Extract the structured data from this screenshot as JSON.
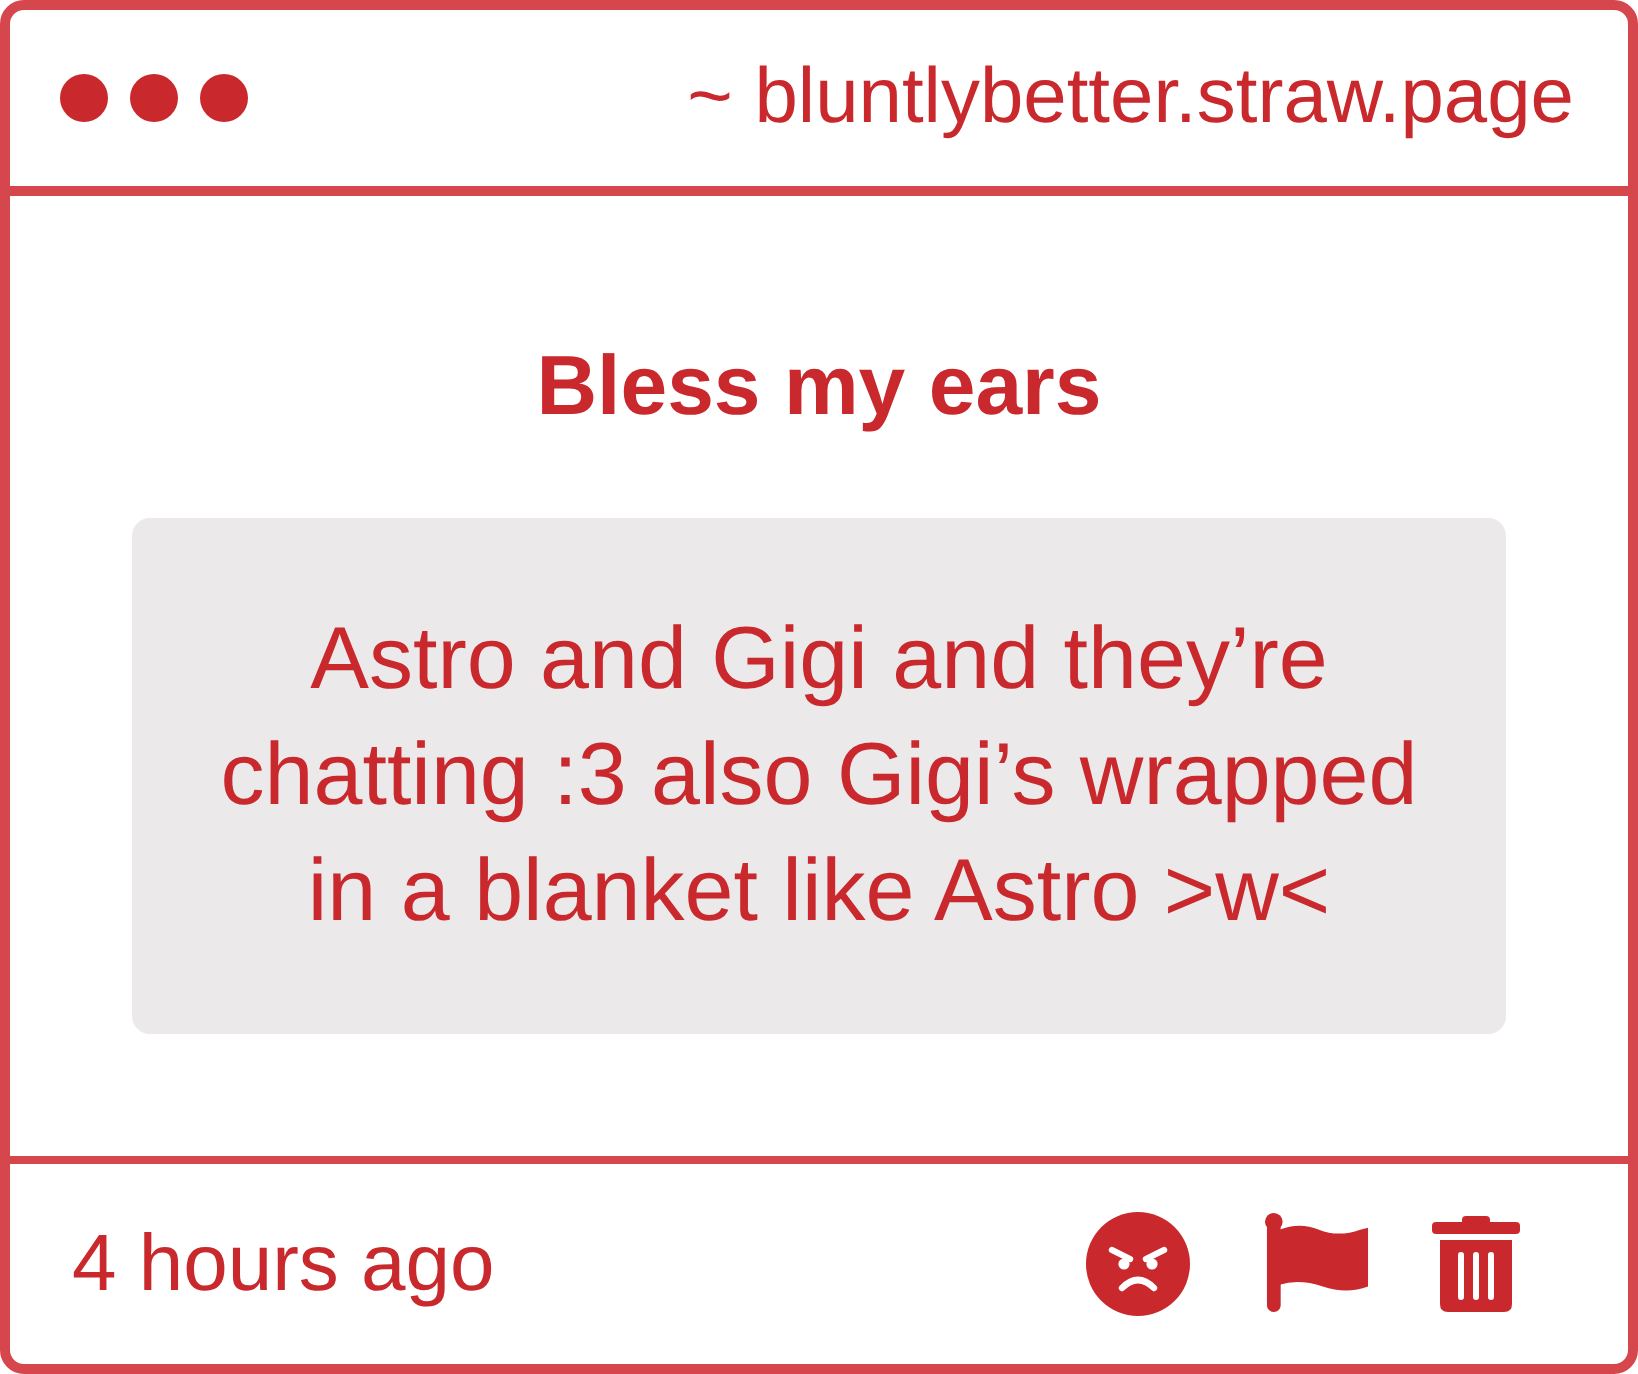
{
  "window": {
    "url": "~ bluntlybetter.straw.page"
  },
  "post": {
    "title": "Bless my ears",
    "message": "Astro and Gigi and they’re chatting :3 also Gigi’s wrapped in a blanket like Astro >w<"
  },
  "footer": {
    "time": "4 hours ago"
  }
}
